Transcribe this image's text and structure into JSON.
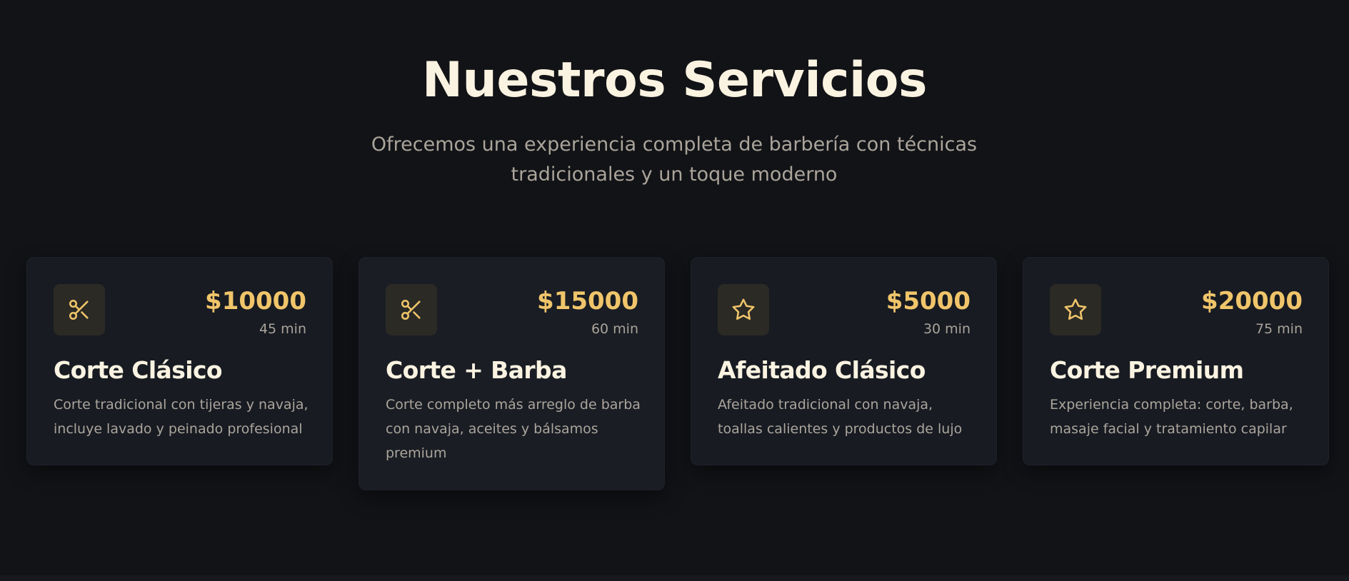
{
  "section": {
    "title": "Nuestros Servicios",
    "subtitle": "Ofrecemos una experiencia completa de barbería con técnicas tradicionales y un toque moderno"
  },
  "services": [
    {
      "icon": "scissors-icon",
      "price": "$10000",
      "duration": "45 min",
      "title": "Corte Clásico",
      "description": "Corte tradicional con tijeras y navaja, incluye lavado y peinado profesional"
    },
    {
      "icon": "scissors-icon",
      "price": "$15000",
      "duration": "60 min",
      "title": "Corte + Barba",
      "description": "Corte completo más arreglo de barba con navaja, aceites y bálsamos premium"
    },
    {
      "icon": "star-icon",
      "price": "$5000",
      "duration": "30 min",
      "title": "Afeitado Clásico",
      "description": "Afeitado tradicional con navaja, toallas calientes y productos de lujo"
    },
    {
      "icon": "star-icon",
      "price": "$20000",
      "duration": "75 min",
      "title": "Corte Premium",
      "description": "Experiencia completa: corte, barba, masaje facial y tratamiento capilar"
    }
  ],
  "colors": {
    "background": "#121317",
    "card": "#181b22",
    "accent": "#f0c56a",
    "heading": "#fbf3e1",
    "muted": "#aba59c"
  }
}
